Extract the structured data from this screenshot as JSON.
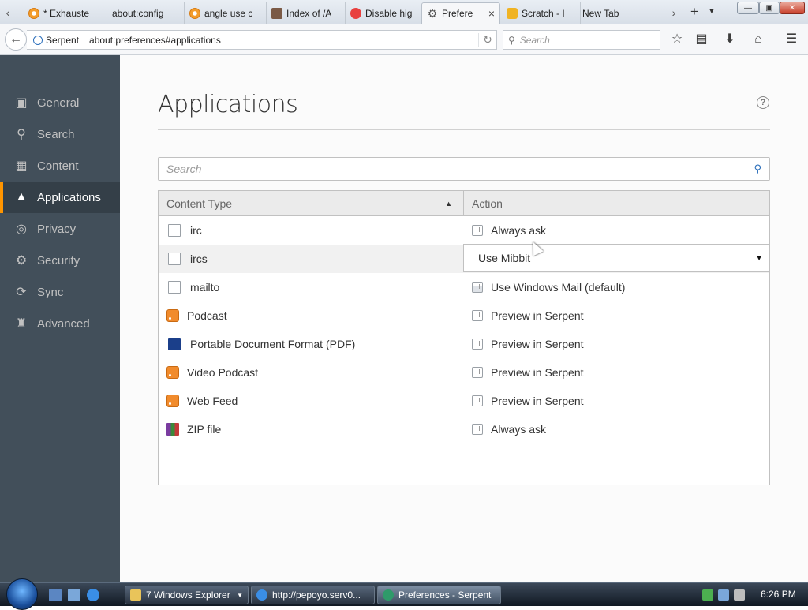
{
  "browser": {
    "tabs": [
      {
        "label": "* Exhauste",
        "favicon": "opera-like-icon",
        "active": false
      },
      {
        "label": "about:config",
        "favicon": "",
        "active": false
      },
      {
        "label": "angle use c",
        "favicon": "opera-like-icon",
        "active": false
      },
      {
        "label": "Index of /A",
        "favicon": "folder-icon",
        "active": false
      },
      {
        "label": "Disable hig",
        "favicon": "firefox-icon",
        "active": false
      },
      {
        "label": "Prefere",
        "favicon": "gear-icon",
        "active": true
      },
      {
        "label": "Scratch - I",
        "favicon": "scratch-icon",
        "active": false
      },
      {
        "label": "New Tab",
        "favicon": "",
        "active": false
      }
    ],
    "identity_label": "Serpent",
    "url": "about:preferences#applications",
    "search_placeholder": "Search"
  },
  "sidebar": {
    "items": [
      {
        "label": "General",
        "icon": "general-icon"
      },
      {
        "label": "Search",
        "icon": "search-icon"
      },
      {
        "label": "Content",
        "icon": "content-icon"
      },
      {
        "label": "Applications",
        "icon": "applications-icon",
        "selected": true
      },
      {
        "label": "Privacy",
        "icon": "privacy-mask-icon"
      },
      {
        "label": "Security",
        "icon": "security-lock-icon"
      },
      {
        "label": "Sync",
        "icon": "sync-icon"
      },
      {
        "label": "Advanced",
        "icon": "advanced-wizard-icon"
      }
    ]
  },
  "main": {
    "title": "Applications",
    "help": "?",
    "filter_placeholder": "Search",
    "columns": {
      "content_type": "Content Type",
      "action": "Action"
    },
    "rows": [
      {
        "type": "irc",
        "type_icon": "file",
        "action": "Always ask",
        "action_icon": "ask"
      },
      {
        "type": "ircs",
        "type_icon": "file",
        "action": "Use Mibbit",
        "selected": true
      },
      {
        "type": "mailto",
        "type_icon": "file",
        "action": "Use Windows Mail (default)",
        "action_icon": "app"
      },
      {
        "type": "Podcast",
        "type_icon": "rss",
        "action": "Preview in Serpent",
        "action_icon": "ask"
      },
      {
        "type": "Portable Document Format (PDF)",
        "type_icon": "pdf",
        "action": "Preview in Serpent",
        "action_icon": "ask"
      },
      {
        "type": "Video Podcast",
        "type_icon": "rss",
        "action": "Preview in Serpent",
        "action_icon": "ask"
      },
      {
        "type": "Web Feed",
        "type_icon": "rss",
        "action": "Preview in Serpent",
        "action_icon": "ask"
      },
      {
        "type": "ZIP file",
        "type_icon": "zip",
        "action": "Always ask",
        "action_icon": "ask"
      }
    ]
  },
  "taskbar": {
    "tasks": [
      {
        "label": "7 Windows Explorer",
        "icon": "folder-icon"
      },
      {
        "label": "http://pepoyo.serv0...",
        "icon": "ie-icon"
      },
      {
        "label": "Preferences - Serpent",
        "icon": "serpent-icon",
        "active": true
      }
    ],
    "clock": "6:26 PM"
  },
  "colors": {
    "sidebar_bg": "#424f5a",
    "sidebar_selected_bg": "#343f48",
    "accent": "#ff9500",
    "link_blue": "#2c6fbb"
  }
}
